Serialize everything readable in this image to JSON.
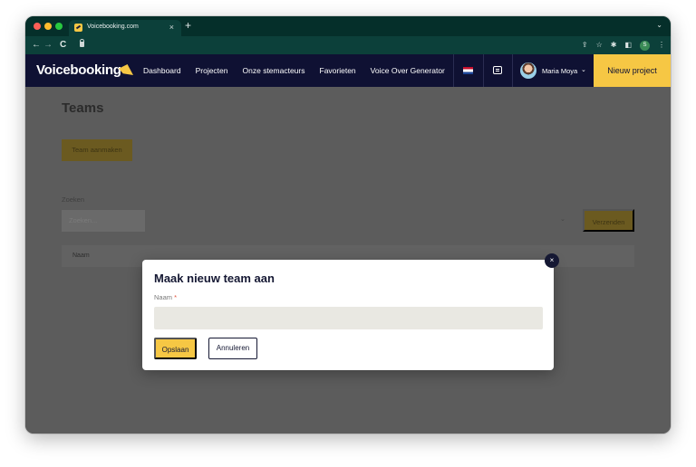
{
  "browser": {
    "tab_title": "Voicebooking.com",
    "tab_close": "×",
    "new_tab": "+",
    "tab_menu": "⌄",
    "profile_initial": "S",
    "nav": {
      "back": "←",
      "forward": "→",
      "reload": "C"
    },
    "toolbar_icons": [
      "share-icon",
      "star-icon",
      "extensions-icon",
      "sidepanel-icon",
      "profile-icon",
      "menu-icon"
    ]
  },
  "site_nav": {
    "logo": "Voicebooking",
    "links": [
      "Dashboard",
      "Projecten",
      "Onze stemacteurs",
      "Favorieten",
      "Voice Over Generator"
    ],
    "user_name": "Maria Moya",
    "user_chevron": "⌄",
    "cta": "Nieuw project",
    "colors": {
      "nav_bg": "#0f1133",
      "accent": "#f6c744"
    }
  },
  "page": {
    "title": "Teams",
    "create_button": "Team aanmaken",
    "search_label": "Zoeken",
    "search_placeholder": "Zoeken...",
    "submit_button": "Verzenden",
    "table_columns": [
      "Naam"
    ]
  },
  "modal": {
    "title": "Maak nieuw team aan",
    "field_label": "Naam",
    "required_marker": "*",
    "name_value": "",
    "save_button": "Opslaan",
    "cancel_button": "Annuleren",
    "close_symbol": "×"
  }
}
